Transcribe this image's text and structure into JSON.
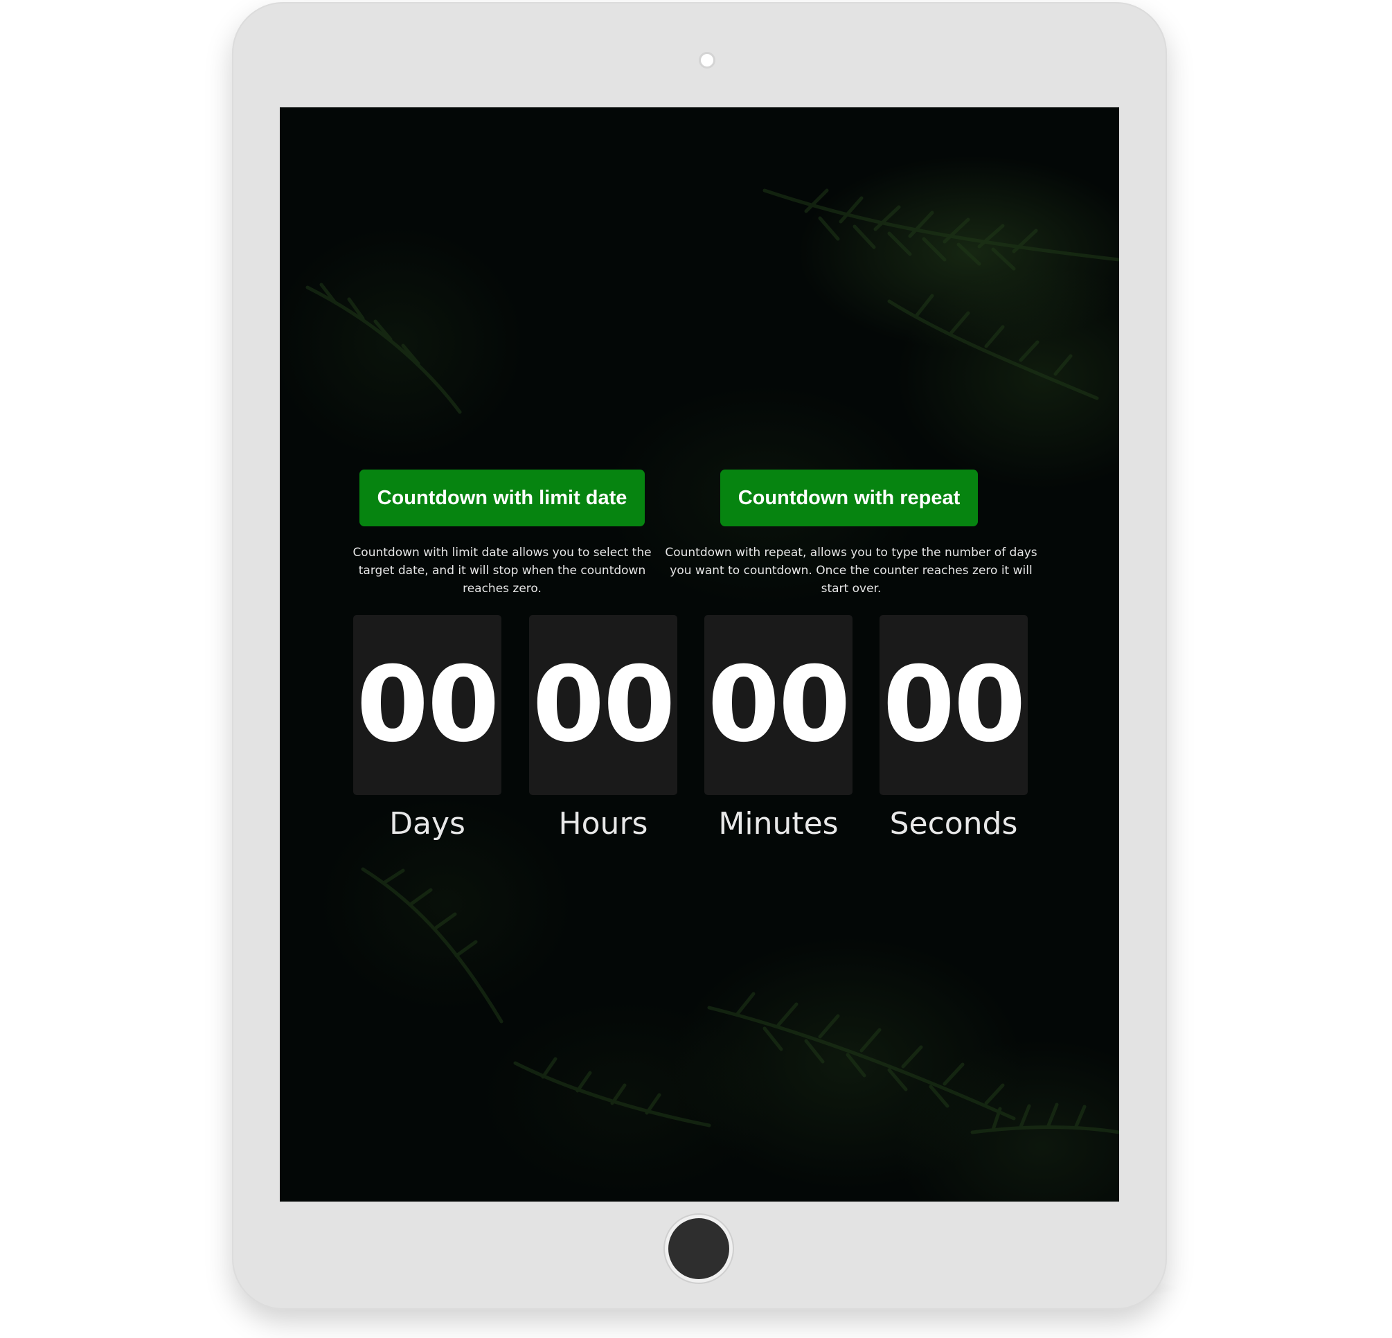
{
  "buttons": {
    "limit_date": "Countdown with limit date",
    "repeat": "Countdown with repeat"
  },
  "descriptions": {
    "limit_date": "Countdown with limit date allows you to select the target date, and it will stop when the countdown reaches zero.",
    "repeat": "Countdown with repeat, allows you to type the number of days you want to countdown. Once the counter reaches zero it will start over."
  },
  "timer": {
    "days": {
      "value": "00",
      "label": "Days"
    },
    "hours": {
      "value": "00",
      "label": "Hours"
    },
    "minutes": {
      "value": "00",
      "label": "Minutes"
    },
    "seconds": {
      "value": "00",
      "label": "Seconds"
    }
  },
  "colors": {
    "button_background": "#068410",
    "timer_box_background": "#1a1a1a",
    "screen_background": "#030706",
    "device_frame": "#e3e3e3",
    "home_button": "#2e2e2e"
  }
}
